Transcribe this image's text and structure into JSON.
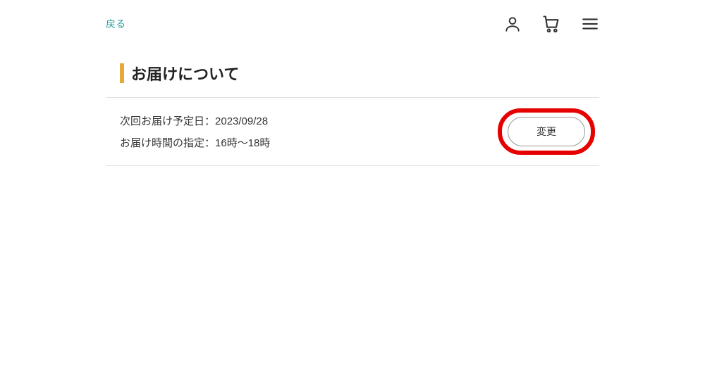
{
  "header": {
    "back_label": "戻る"
  },
  "section": {
    "title": "お届けについて"
  },
  "delivery": {
    "next_date_label": "次回お届け予定日：",
    "next_date_value": "2023/09/28",
    "time_label": "お届け時間の指定：",
    "time_value": "16時～18時",
    "change_button_label": "変更"
  }
}
